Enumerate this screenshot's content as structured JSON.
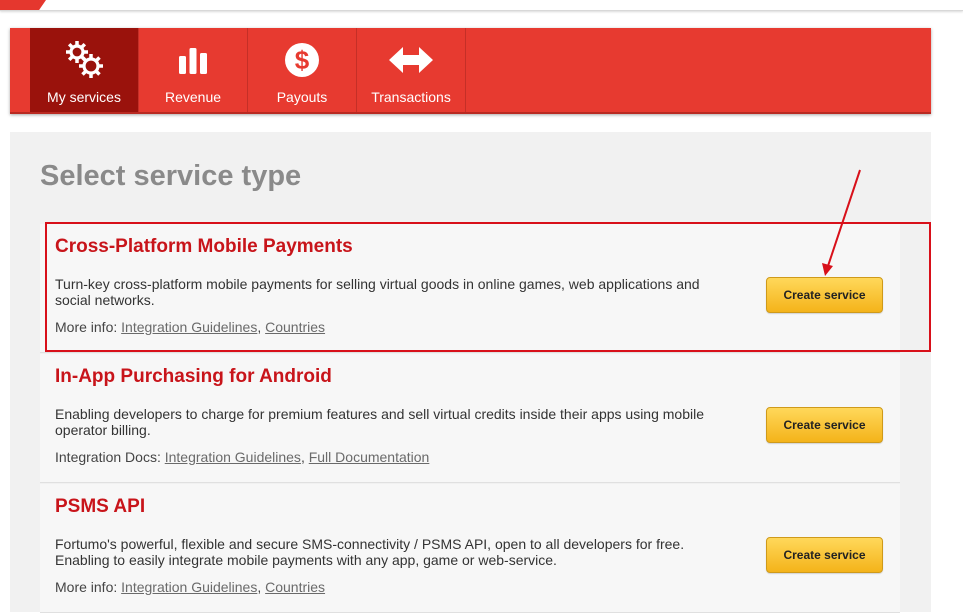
{
  "nav": {
    "items": [
      {
        "label": "My services",
        "icon": "gears-icon"
      },
      {
        "label": "Revenue",
        "icon": "bar-chart-icon"
      },
      {
        "label": "Payouts",
        "icon": "dollar-icon"
      },
      {
        "label": "Transactions",
        "icon": "exchange-arrows-icon"
      }
    ],
    "active": "My services"
  },
  "page": {
    "title": "Select service type"
  },
  "services": [
    {
      "title": "Cross-Platform Mobile Payments",
      "description": "Turn-key cross-platform mobile payments for selling virtual goods in online games, web applications and social networks.",
      "info_prefix": "More info:",
      "links": [
        "Integration Guidelines",
        "Countries"
      ],
      "button": "Create service",
      "highlighted": true
    },
    {
      "title": "In-App Purchasing for Android",
      "description": "Enabling developers to charge for premium features and sell virtual credits inside their apps using mobile operator billing.",
      "info_prefix": "Integration Docs:",
      "links": [
        "Integration Guidelines",
        "Full Documentation"
      ],
      "button": "Create service",
      "highlighted": false
    },
    {
      "title": "PSMS API",
      "description": "Fortumo's powerful, flexible and secure SMS-connectivity / PSMS API, open to all developers for free. Enabling to easily integrate mobile payments with any app, game or web-service.",
      "info_prefix": "More info:",
      "links": [
        "Integration Guidelines",
        "Countries"
      ],
      "button": "Create service",
      "highlighted": false
    }
  ],
  "colors": {
    "nav_background": "#e73a30",
    "nav_active": "#9a120c",
    "service_title": "#c8141a",
    "button": "#f4b31a",
    "annotation": "#d8101a"
  }
}
